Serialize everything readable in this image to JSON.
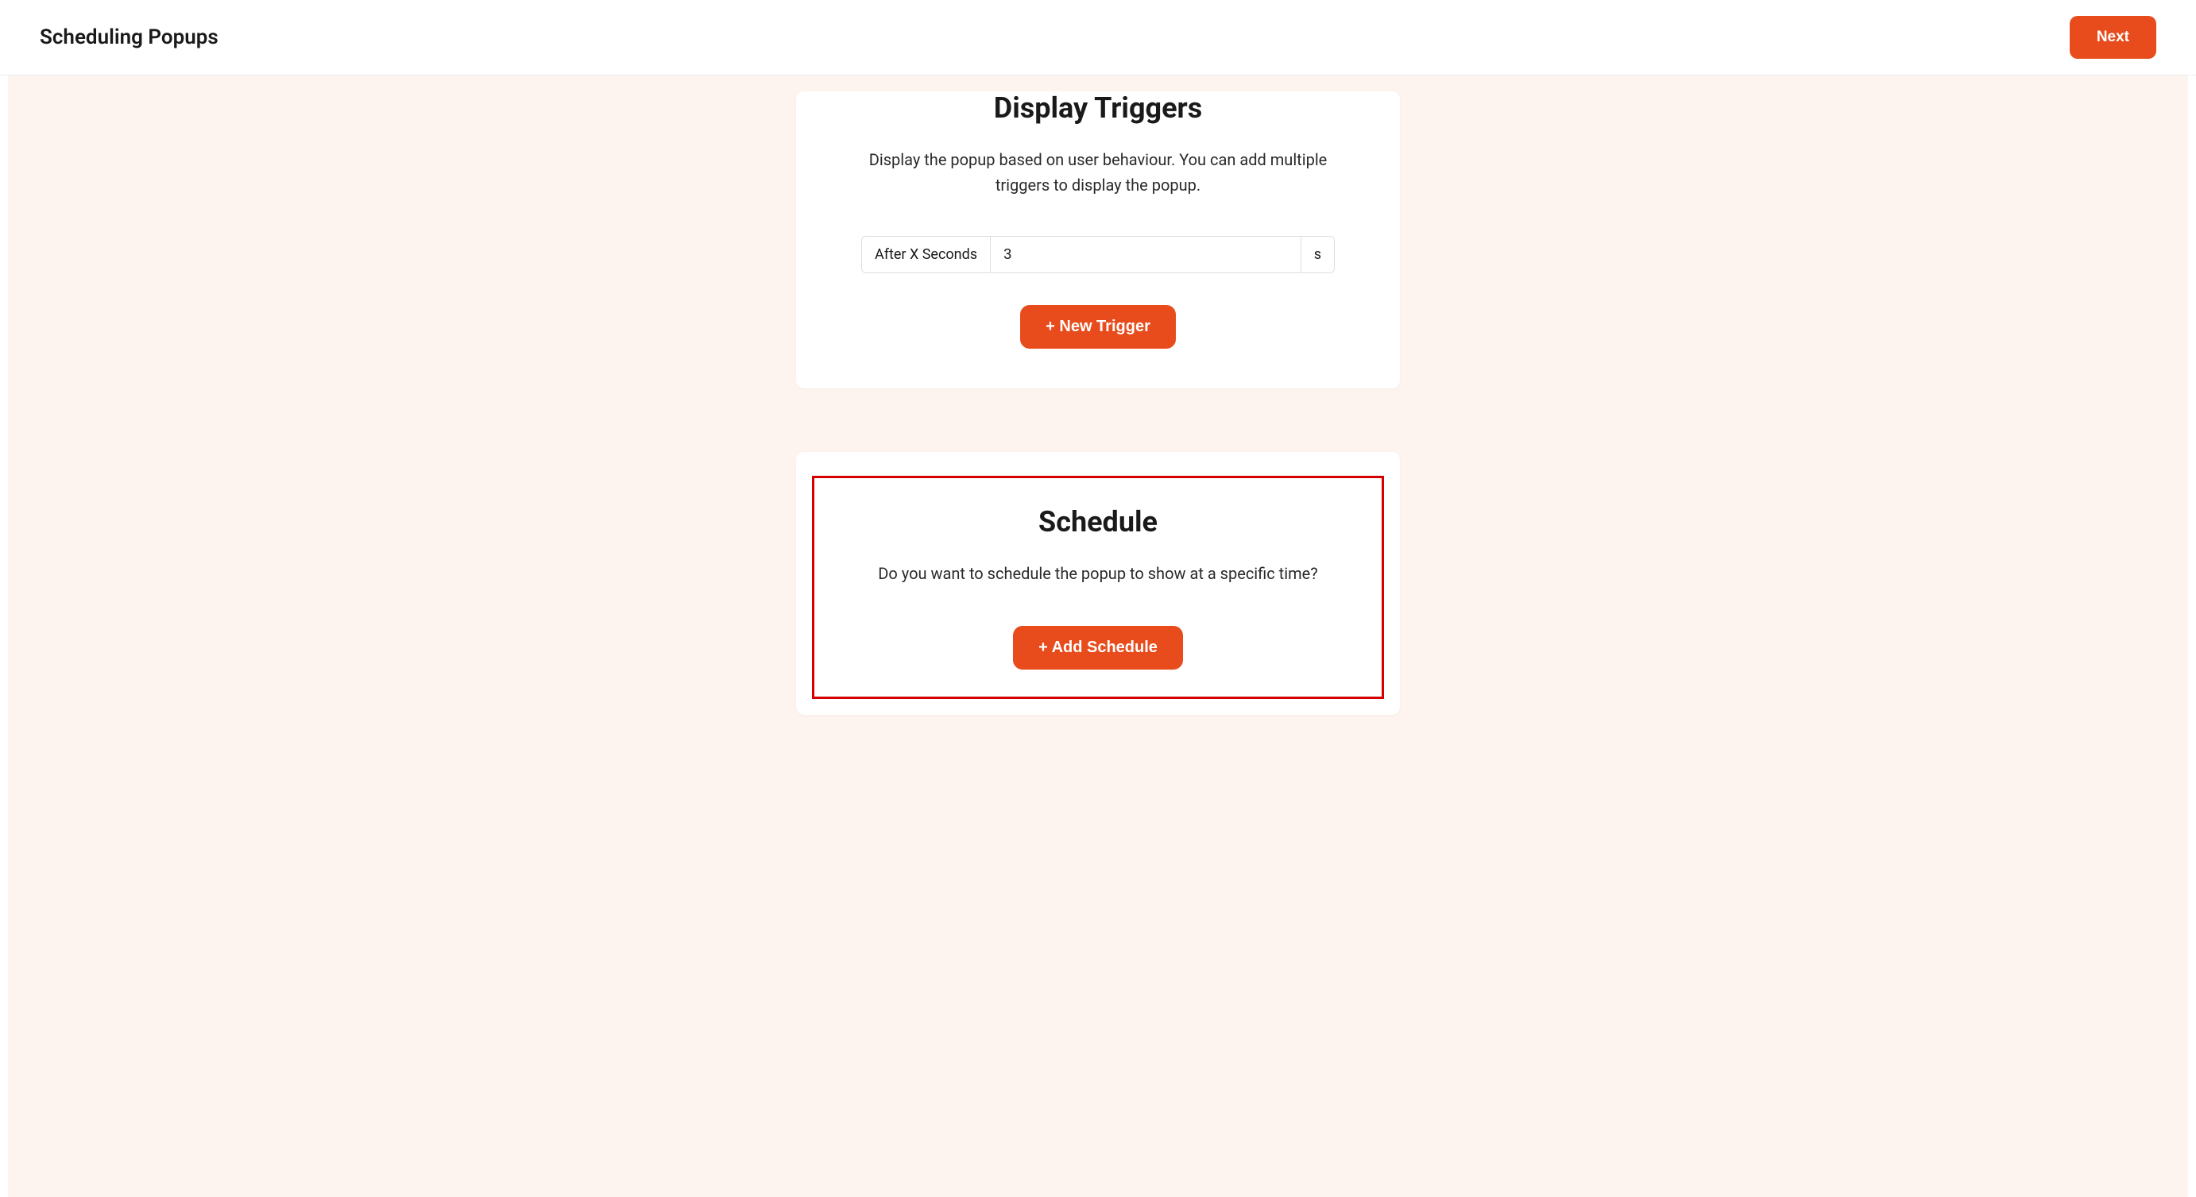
{
  "header": {
    "title": "Scheduling Popups",
    "next_label": "Next"
  },
  "triggers": {
    "title": "Display Triggers",
    "description": "Display the popup based on user behaviour. You can add multiple triggers to display the popup.",
    "row": {
      "type_label": "After X Seconds",
      "value": "3",
      "unit": "s"
    },
    "new_trigger_label": "+ New Trigger"
  },
  "schedule": {
    "title": "Schedule",
    "description": "Do you want to schedule the popup to show at a specific time?",
    "add_schedule_label": "+ Add Schedule"
  }
}
